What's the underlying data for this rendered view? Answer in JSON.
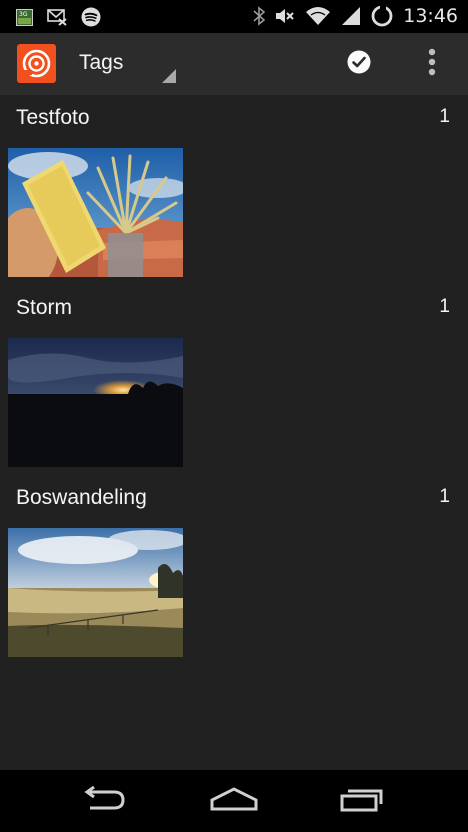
{
  "status_bar": {
    "time": "13:46",
    "icons_left": [
      "gallery-icon",
      "mail-muted-icon",
      "spotify-icon"
    ],
    "icons_right": [
      "bluetooth-icon",
      "volume-muted-icon",
      "wifi-icon",
      "signal-icon",
      "battery-charging-icon"
    ]
  },
  "action_bar": {
    "title": "Tags",
    "accent_color": "#f2501e",
    "actions": [
      "done-check-icon",
      "overflow-menu-icon"
    ]
  },
  "tags": [
    {
      "name": "Testfoto",
      "count": "1"
    },
    {
      "name": "Storm",
      "count": "1"
    },
    {
      "name": "Boswandeling",
      "count": "1"
    }
  ],
  "nav_bar": [
    "back-icon",
    "home-icon",
    "recents-icon"
  ]
}
